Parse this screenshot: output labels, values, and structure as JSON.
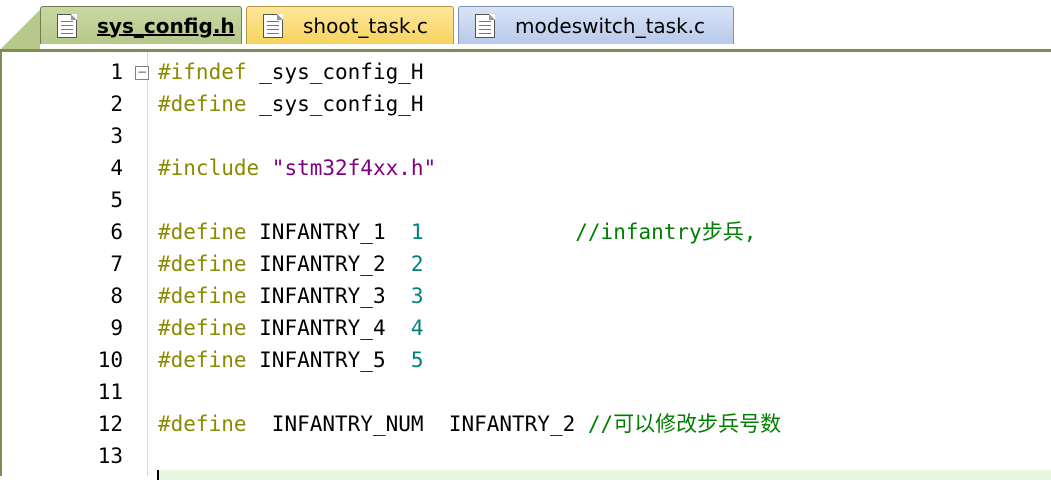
{
  "tabs": [
    {
      "label": "sys_config.h",
      "active": true
    },
    {
      "label": "shoot_task.c",
      "active": false
    },
    {
      "label": "modeswitch_task.c",
      "active": false
    }
  ],
  "editor": {
    "lines": [
      {
        "num": "1",
        "fold": "−",
        "pp": "#ifndef",
        "rest": " _sys_config_H"
      },
      {
        "num": "2",
        "pp": "#define",
        "rest": " _sys_config_H"
      },
      {
        "num": "3"
      },
      {
        "num": "4",
        "pp": "#include",
        "str": " \"stm32f4xx.h\""
      },
      {
        "num": "5"
      },
      {
        "num": "6",
        "pp": "#define",
        "rest": " INFANTRY_1  ",
        "numval": "1",
        "cmt": "            //infantry步兵,"
      },
      {
        "num": "7",
        "pp": "#define",
        "rest": " INFANTRY_2  ",
        "numval": "2"
      },
      {
        "num": "8",
        "pp": "#define",
        "rest": " INFANTRY_3  ",
        "numval": "3"
      },
      {
        "num": "9",
        "pp": "#define",
        "rest": " INFANTRY_4  ",
        "numval": "4"
      },
      {
        "num": "10",
        "pp": "#define",
        "rest": " INFANTRY_5  ",
        "numval": "5"
      },
      {
        "num": "11"
      },
      {
        "num": "12",
        "pp": "#define",
        "rest": "  INFANTRY_NUM  INFANTRY_2",
        "cmt": " //可以修改步兵号数"
      },
      {
        "num": "13"
      }
    ]
  },
  "colors": {
    "preprocessor": "#8a8a00",
    "string": "#800080",
    "number": "#008080",
    "comment": "#008000"
  }
}
